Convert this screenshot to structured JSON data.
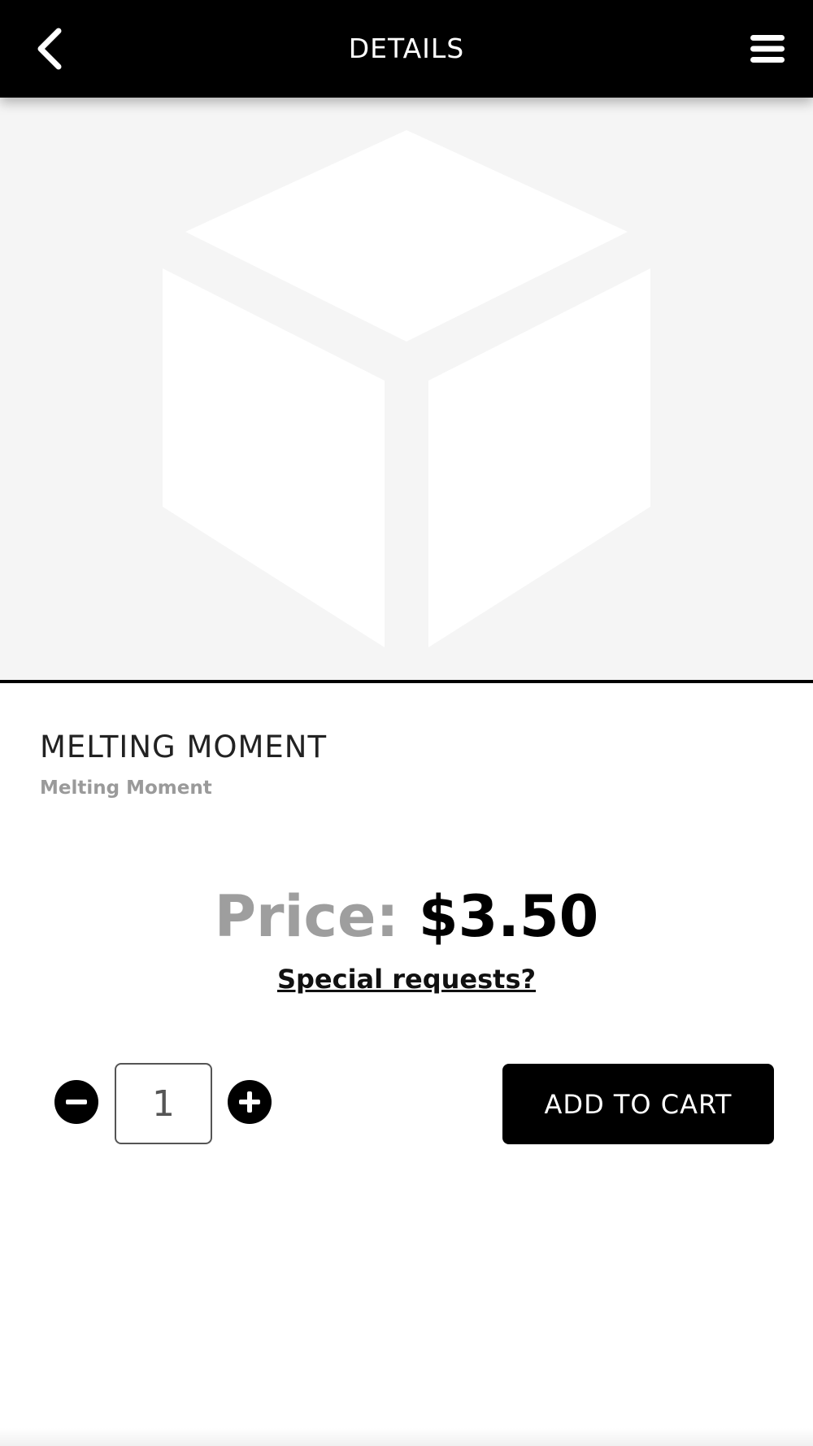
{
  "header": {
    "title": "DETAILS",
    "back_icon": "chevron-left-icon",
    "menu_icon": "hamburger-menu-icon"
  },
  "product": {
    "image_icon": "package-box-placeholder-icon",
    "name": "MELTING MOMENT",
    "subtitle": "Melting Moment",
    "price_label": "Price:",
    "price_value": "$3.50",
    "special_requests_label": "Special requests?"
  },
  "quantity": {
    "value": "1",
    "decrement_icon": "minus-circle-icon",
    "increment_icon": "plus-circle-icon"
  },
  "actions": {
    "add_to_cart_label": "ADD TO CART"
  },
  "colors": {
    "header_bg": "#000000",
    "image_bg": "#f5f5f5",
    "price_label": "#9e9e9e",
    "subtitle": "#9a9a9a",
    "button_bg": "#000000"
  }
}
